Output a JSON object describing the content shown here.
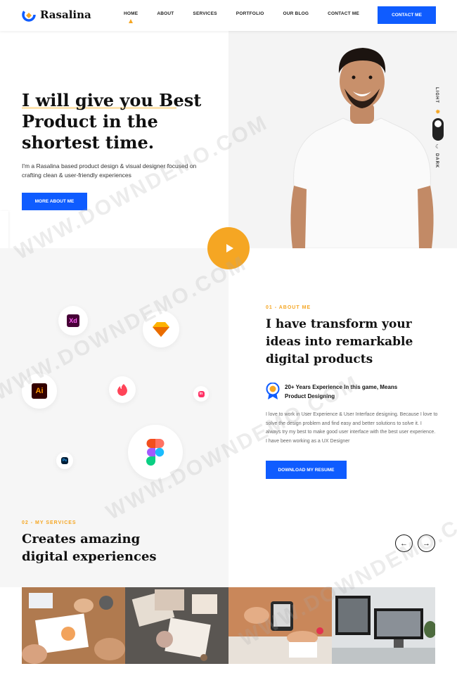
{
  "brand": {
    "name": "Rasalina",
    "accent": "#f5a623",
    "primary": "#0f5cff"
  },
  "nav": {
    "items": [
      "HOME",
      "ABOUT",
      "SERVICES",
      "PORTFOLIO",
      "OUR BLOG",
      "CONTACT ME"
    ],
    "active": "HOME",
    "cta": "CONTACT ME"
  },
  "hero": {
    "title": "I will give you Best Product in the shortest time.",
    "description": "I'm a Rasalina based product design & visual designer focused on crafting clean & user-friendly experiences",
    "button": "MORE ABOUT ME",
    "theme_light": "LIGHT",
    "theme_dark": "DARK"
  },
  "about": {
    "eyebrow": "01 - ABOUT ME",
    "title": "I have transform your ideas into remarkable digital products",
    "badge": "20+ Years Experience In this game, Means Product Designing",
    "description": "I love to work in User Experience & User Interface designing. Because I love to solve the design problem and find easy and better solutions to solve it. I always try my best to make good user interface with the best user experience. I have been working as a UX Designer",
    "button": "DOWNLOAD MY RESUME",
    "app_icons": [
      "xd-icon",
      "sketch-icon",
      "illustrator-icon",
      "tinder-icon",
      "invision-icon",
      "figma-icon",
      "photoshop-icon"
    ]
  },
  "services": {
    "eyebrow": "02 - MY SERVICES",
    "title": "Creates amazing digital experiences"
  },
  "watermark": "WWW.DOWNDEMO.COM"
}
